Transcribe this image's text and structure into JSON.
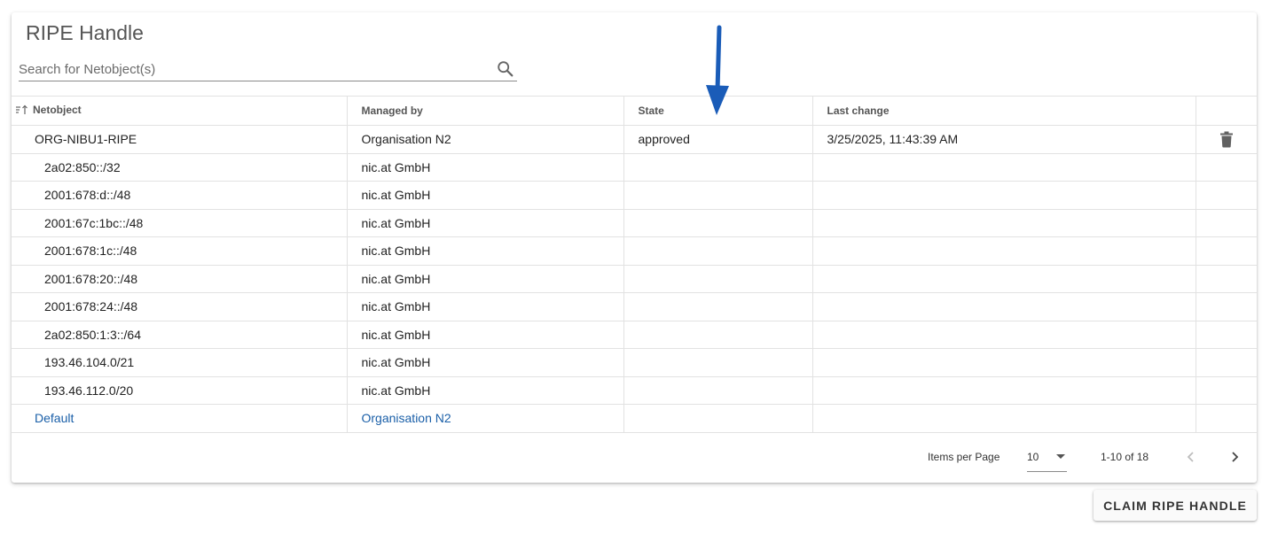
{
  "card": {
    "title": "RIPE Handle",
    "search": {
      "placeholder": "Search for Netobject(s)",
      "value": "",
      "icon": "search-icon"
    }
  },
  "table": {
    "headers": {
      "netobject": "Netobject",
      "managed_by": "Managed by",
      "state": "State",
      "last_change": "Last change"
    },
    "parent_row": {
      "netobject": "ORG-NIBU1-RIPE",
      "managed_by": "Organisation N2",
      "state": "approved",
      "last_change": "3/25/2025, 11:43:39 AM",
      "action_icon": "trash-icon"
    },
    "child_rows": [
      {
        "netobject": "2a02:850::/32",
        "managed_by": "nic.at GmbH"
      },
      {
        "netobject": "2001:678:d::/48",
        "managed_by": "nic.at GmbH"
      },
      {
        "netobject": "2001:67c:1bc::/48",
        "managed_by": "nic.at GmbH"
      },
      {
        "netobject": "2001:678:1c::/48",
        "managed_by": "nic.at GmbH"
      },
      {
        "netobject": "2001:678:20::/48",
        "managed_by": "nic.at GmbH"
      },
      {
        "netobject": "2001:678:24::/48",
        "managed_by": "nic.at GmbH"
      },
      {
        "netobject": "2a02:850:1:3::/64",
        "managed_by": "nic.at GmbH"
      },
      {
        "netobject": "193.46.104.0/21",
        "managed_by": "nic.at GmbH"
      },
      {
        "netobject": "193.46.112.0/20",
        "managed_by": "nic.at GmbH"
      }
    ],
    "default_row": {
      "netobject": "Default",
      "managed_by": "Organisation N2"
    }
  },
  "paginator": {
    "items_per_page_label": "Items per Page",
    "items_per_page_value": "10",
    "range_label": "1-10 of 18"
  },
  "claim_button_label": "CLAIM RIPE HANDLE",
  "colors": {
    "link": "#1a5fa8",
    "annotation_arrow": "#1a5cb8"
  }
}
